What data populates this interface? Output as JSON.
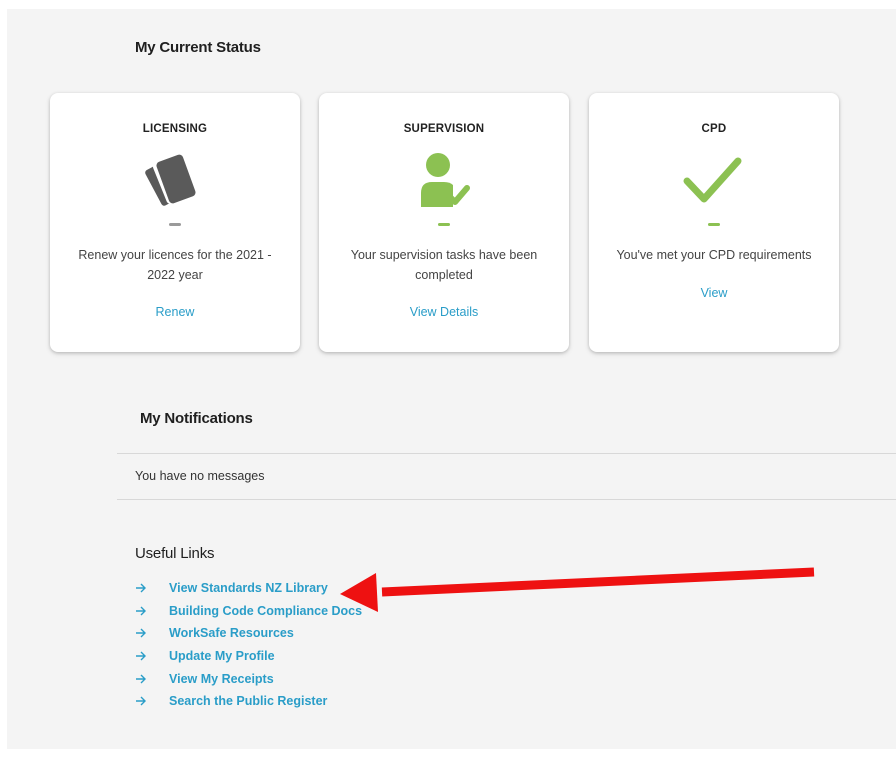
{
  "status": {
    "title": "My Current Status",
    "cards": [
      {
        "title": "LICENSING",
        "icon": "license-cards-icon",
        "text": "Renew your licences for the 2021 - 2022 year",
        "link": "Renew",
        "dash_color": "#9a9a9a"
      },
      {
        "title": "SUPERVISION",
        "icon": "person-check-icon",
        "text": "Your supervision tasks have been completed",
        "link": "View Details",
        "dash_color": "#8cc152"
      },
      {
        "title": "CPD",
        "icon": "checkmark-icon",
        "text": "You've met your CPD requirements",
        "link": "View",
        "dash_color": "#8cc152"
      }
    ]
  },
  "notifications": {
    "title": "My Notifications",
    "empty_text": "You have no messages"
  },
  "useful_links": {
    "title": "Useful Links",
    "items": [
      "View Standards NZ Library",
      "Building Code Compliance Docs",
      "WorkSafe Resources",
      "Update My Profile",
      "View My Receipts",
      "Search the Public Register"
    ]
  },
  "colors": {
    "link": "#2a9dc8",
    "green": "#8cc152",
    "gray_icon": "#5a5a5a",
    "annotation_arrow": "#ee1111"
  }
}
